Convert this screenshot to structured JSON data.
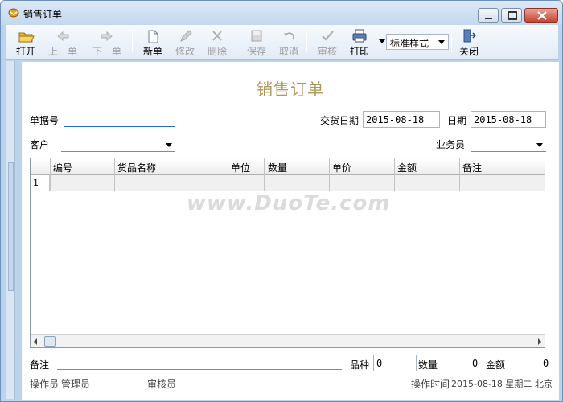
{
  "window": {
    "title": "销售订单"
  },
  "toolbar": {
    "open": "打开",
    "prev": "上一单",
    "next": "下一单",
    "new": "新单",
    "edit": "修改",
    "delete": "删除",
    "save": "保存",
    "cancel": "取消",
    "audit": "审核",
    "print": "打印",
    "print_style": "标准样式",
    "close": "关闭"
  },
  "form": {
    "title": "销售订单",
    "doc_no_label": "单据号",
    "doc_no_value": "",
    "delivery_date_label": "交货日期",
    "delivery_date_value": "2015-08-18",
    "date_label": "日期",
    "date_value": "2015-08-18",
    "customer_label": "客户",
    "customer_value": "",
    "salesman_label": "业务员",
    "salesman_value": ""
  },
  "grid": {
    "columns": [
      "编号",
      "货品名称",
      "单位",
      "数量",
      "单价",
      "金额",
      "备注"
    ],
    "rows": [
      {
        "row_no": "1",
        "cells": [
          "",
          "",
          "",
          "",
          "",
          "",
          ""
        ]
      }
    ]
  },
  "watermark": "www.DuoTe.com",
  "footer": {
    "note_label": "备注",
    "variety_label": "品种",
    "variety_value": "0",
    "quantity_label": "数量",
    "quantity_value": "0",
    "amount_label": "金额",
    "amount_value": "0",
    "operator_label": "操作员",
    "operator_value": "管理员",
    "auditor_label": "审核员",
    "op_time_label": "操作时间",
    "op_time_value": "2015-08-18 星期二 北京"
  }
}
